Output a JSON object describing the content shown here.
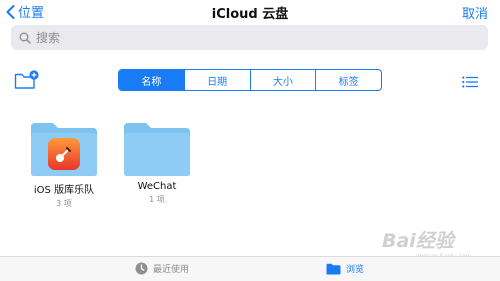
{
  "navbar": {
    "back_label": "位置",
    "title": "iCloud 云盘",
    "cancel_label": "取消"
  },
  "search": {
    "placeholder": "搜索"
  },
  "sort_tabs": [
    {
      "label": "名称",
      "active": true
    },
    {
      "label": "日期",
      "active": false
    },
    {
      "label": "大小",
      "active": false
    },
    {
      "label": "标签",
      "active": false
    }
  ],
  "items": [
    {
      "name": "iOS 版库乐队",
      "count": "3 项",
      "icon": "garageband-app-icon"
    },
    {
      "name": "WeChat",
      "count": "1 项",
      "icon": "folder-icon"
    }
  ],
  "tabbar": {
    "recent_label": "最近使用",
    "browse_label": "浏览"
  },
  "watermark": {
    "text": "Bai经验",
    "sub": "jingyan.baidu.com"
  },
  "colors": {
    "accent": "#1a7cf5",
    "folder": "#8fccf5"
  }
}
